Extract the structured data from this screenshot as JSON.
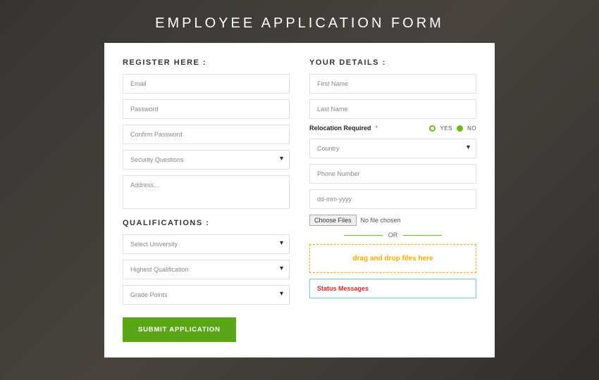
{
  "title": "EMPLOYEE APPLICATION FORM",
  "left": {
    "registerHead": "REGISTER HERE :",
    "email": "Email",
    "password": "Password",
    "confirm": "Confirm Password",
    "security": "Security Questions",
    "address": "Address...",
    "qualHead": "QUALIFICATIONS :",
    "university": "Select University",
    "highest": "Highest Qualification",
    "grade": "Grade Points",
    "submit": "SUBMIT APPLICATION"
  },
  "right": {
    "detailsHead": "YOUR DETAILS :",
    "first": "First Name",
    "last": "Last Name",
    "relocLabel": "Relocation Required",
    "asterisk": "*",
    "yes": "YES",
    "no": "NO",
    "country": "Country",
    "phone": "Phone Number",
    "date": "dd-mm-yyyy",
    "chooseFiles": "Choose Files",
    "noFile": "No file chosen",
    "or": "OR",
    "dropzone": "drag and drop files here",
    "status": "Status Messages"
  }
}
